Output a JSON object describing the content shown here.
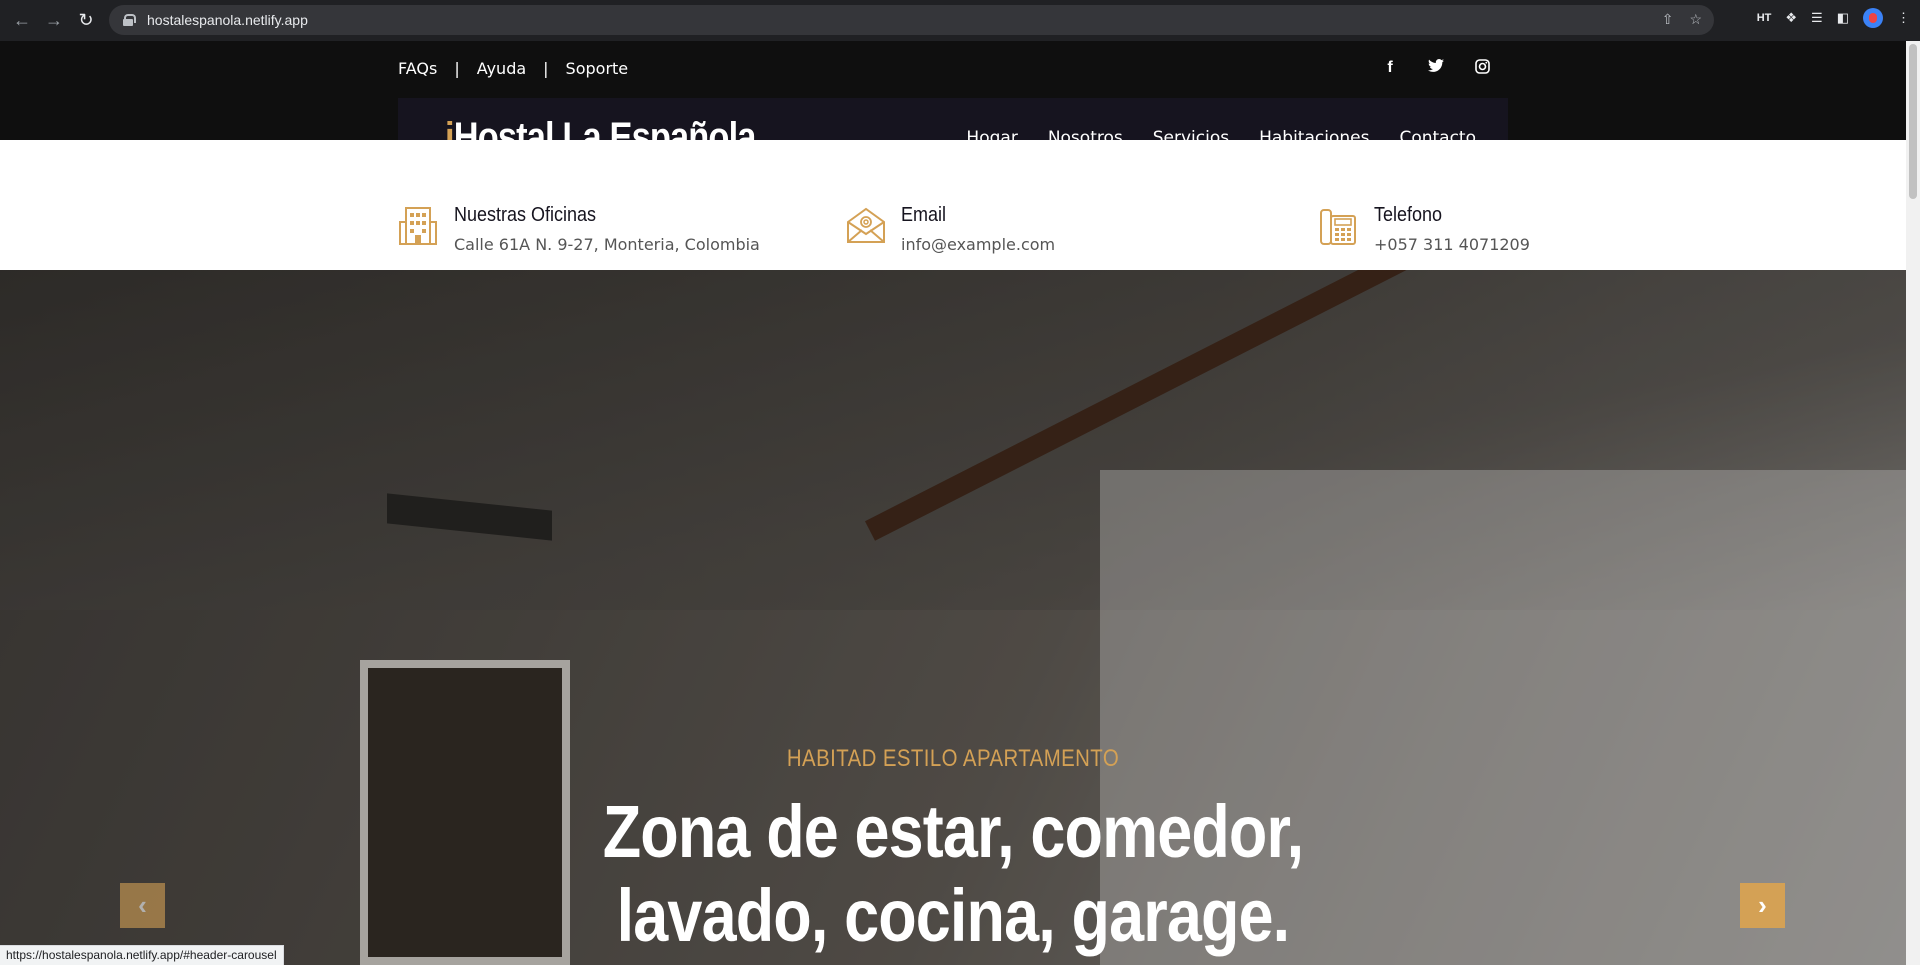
{
  "browser": {
    "url": "hostalespanola.netlify.app",
    "extension_label": "HT",
    "status_url": "https://hostalespanola.netlify.app/#header-carousel"
  },
  "topbar": {
    "links": [
      "FAQs",
      "Ayuda",
      "Soporte"
    ],
    "separator": "|",
    "socials": [
      "facebook-icon",
      "twitter-icon",
      "instagram-icon"
    ]
  },
  "navbar": {
    "logo_accent": "i",
    "logo_text": "Hostal La Española",
    "menu": [
      "Hogar",
      "Nosotros",
      "Servicios",
      "Habitaciones",
      "Contacto"
    ]
  },
  "info": [
    {
      "icon": "building-icon",
      "title": "Nuestras Oficinas",
      "value": "Calle 61A N. 9-27, Monteria, Colombia"
    },
    {
      "icon": "email-envelope-icon",
      "title": "Email",
      "value": "info@example.com"
    },
    {
      "icon": "telephone-icon",
      "title": "Telefono",
      "value": "+057 311 4071209"
    }
  ],
  "hero": {
    "subtitle": "HABITAD ESTILO APARTAMENTO",
    "title_line1": "Zona de estar, comedor,",
    "title_line2": "lavado, cocina, garage."
  },
  "colors": {
    "accent": "#d4a155",
    "dark": "#16141f",
    "topbar": "#0f0f0f"
  }
}
